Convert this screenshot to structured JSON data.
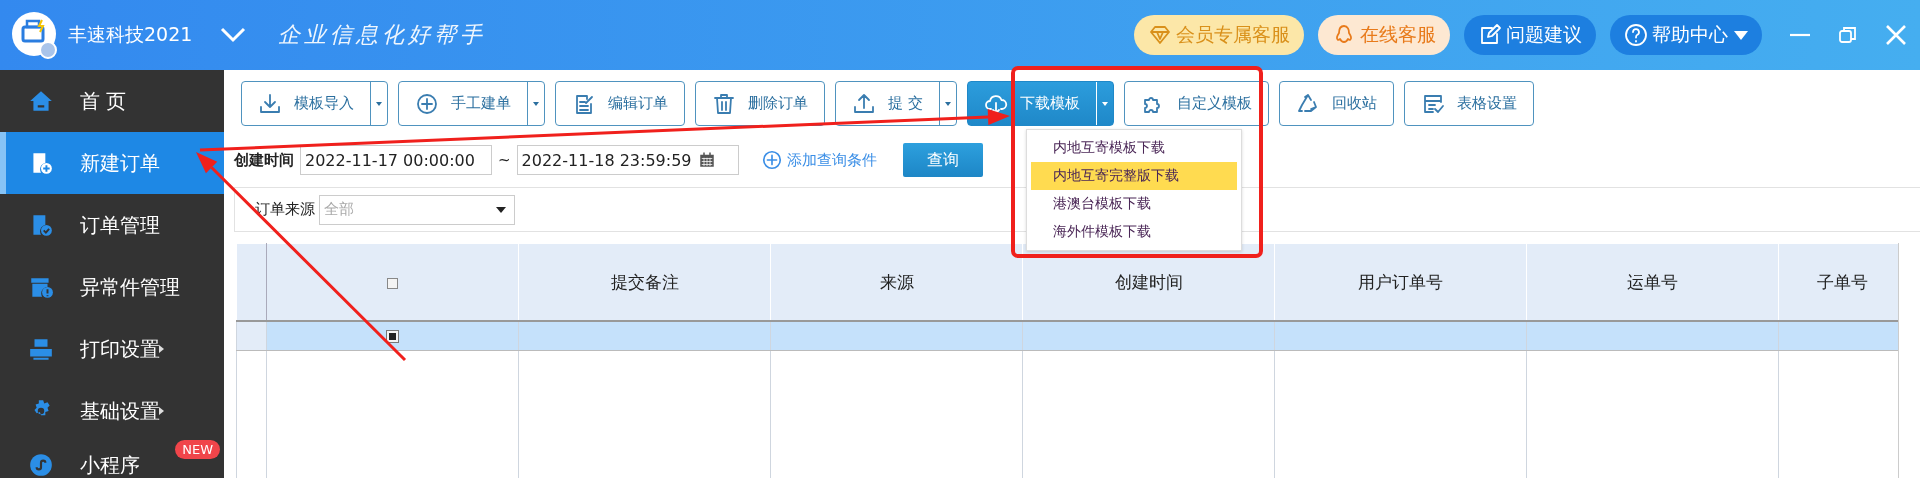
{
  "app": {
    "name": "丰速科技2021",
    "slogan": "企业信息化好帮手"
  },
  "header_buttons": [
    {
      "kind": "vip",
      "label": "会员专属客服"
    },
    {
      "kind": "online",
      "label": "在线客服"
    },
    {
      "kind": "feedback",
      "label": "问题建议"
    },
    {
      "kind": "help",
      "label": "帮助中心"
    }
  ],
  "sidebar": {
    "items": [
      {
        "kind": "home",
        "label": "首 页",
        "selected": false,
        "submenu": false
      },
      {
        "kind": "new-order",
        "label": "新建订单",
        "selected": true,
        "submenu": false
      },
      {
        "kind": "orders",
        "label": "订单管理",
        "selected": false,
        "submenu": false
      },
      {
        "kind": "exception",
        "label": "异常件管理",
        "selected": false,
        "submenu": false
      },
      {
        "kind": "print",
        "label": "打印设置",
        "selected": false,
        "submenu": true
      },
      {
        "kind": "settings",
        "label": "基础设置",
        "selected": false,
        "submenu": true
      },
      {
        "kind": "mini",
        "label": "小程序",
        "selected": false,
        "submenu": false,
        "badge": "NEW"
      }
    ]
  },
  "toolbar": [
    {
      "kind": "import",
      "label": "模板导入",
      "split": true,
      "primary": false
    },
    {
      "kind": "add",
      "label": "手工建单",
      "split": true,
      "primary": false
    },
    {
      "kind": "edit",
      "label": "编辑订单",
      "split": false,
      "primary": false
    },
    {
      "kind": "delete",
      "label": "删除订单",
      "split": false,
      "primary": false
    },
    {
      "kind": "submit",
      "label": "提 交",
      "split": true,
      "primary": false
    },
    {
      "kind": "download",
      "label": "下载模板",
      "split": true,
      "primary": true
    },
    {
      "kind": "custom",
      "label": "自定义模板",
      "split": false,
      "primary": false
    },
    {
      "kind": "recycle",
      "label": "回收站",
      "split": false,
      "primary": false
    },
    {
      "kind": "table",
      "label": "表格设置",
      "split": false,
      "primary": false
    }
  ],
  "download_menu": [
    {
      "label": "内地互寄模板下载",
      "selected": false
    },
    {
      "label": "内地互寄完整版下载",
      "selected": true
    },
    {
      "label": "港澳台模板下载",
      "selected": false
    },
    {
      "label": "海外件模板下载",
      "selected": false
    }
  ],
  "query": {
    "label": "创建时间",
    "start": "2022-11-17 00:00:00",
    "separator": "~",
    "end": "2022-11-18 23:59:59",
    "add_condition": "添加查询条件",
    "button": "查询"
  },
  "filter": {
    "label": "订单来源",
    "placeholder": "全部"
  },
  "table": {
    "header_checked": false,
    "columns": [
      "提交备注",
      "来源",
      "创建时间",
      "用户订单号",
      "运单号",
      "子单号"
    ],
    "rows": [
      {
        "selected": true,
        "checked": true
      }
    ]
  },
  "annotations": [
    {
      "kind": "frame"
    },
    {
      "kind": "arrow"
    },
    {
      "kind": "arrow"
    }
  ]
}
